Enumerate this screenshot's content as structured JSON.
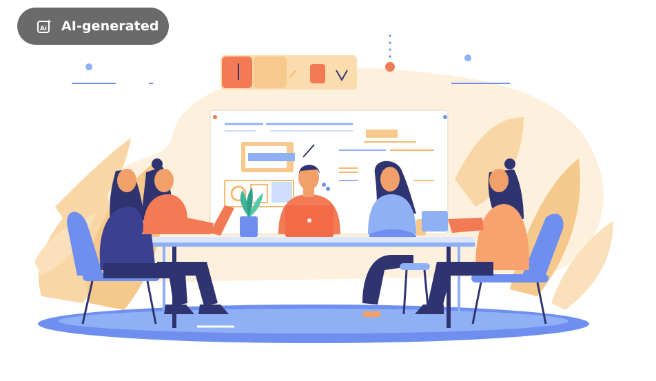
{
  "badge": {
    "label": "AI-generated",
    "icon": "ai-spark-icon",
    "background": "#505050"
  },
  "illustration": {
    "subject": "team-meeting",
    "palette": {
      "cream": "#fde9cb",
      "peach": "#f8d6a6",
      "orange": "#f27a54",
      "navy": "#2f3470",
      "blue": "#6f8ff0",
      "lightBlue": "#8fb0f5",
      "skin": "#f2a06a"
    }
  }
}
